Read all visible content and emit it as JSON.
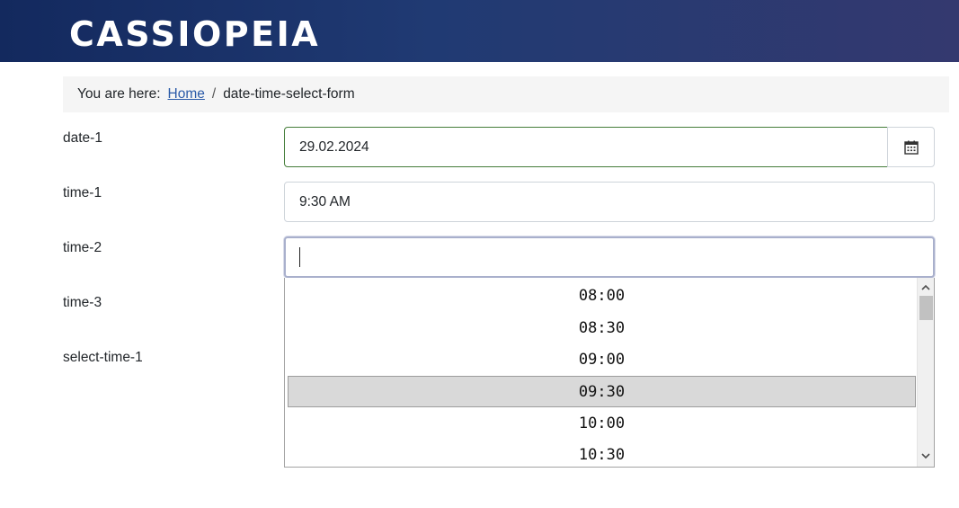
{
  "header": {
    "brand": "CASSIOPEIA"
  },
  "breadcrumb": {
    "prefix": "You are here:",
    "home": "Home",
    "separator": "/",
    "current": "date-time-select-form"
  },
  "form": {
    "date1": {
      "label": "date-1",
      "value": "29.02.2024"
    },
    "time1": {
      "label": "time-1",
      "value": "9:30 AM"
    },
    "time2": {
      "label": "time-2",
      "value": ""
    },
    "time3": {
      "label": "time-3"
    },
    "selectTime1": {
      "label": "select-time-1"
    }
  },
  "dropdown": {
    "options": [
      "08:00",
      "08:30",
      "09:00",
      "09:30",
      "10:00",
      "10:30"
    ],
    "selected": "09:30"
  },
  "icons": {
    "calendar": "calendar-icon",
    "scroll_up": "chevron-up-icon",
    "scroll_down": "chevron-down-icon"
  },
  "colors": {
    "header_start": "#13295e",
    "header_end": "#34396f",
    "link": "#2a5aa8",
    "valid_border": "#457d3a",
    "focus_border": "#a9b0cc",
    "selected_option_bg": "#d9d9d9"
  }
}
